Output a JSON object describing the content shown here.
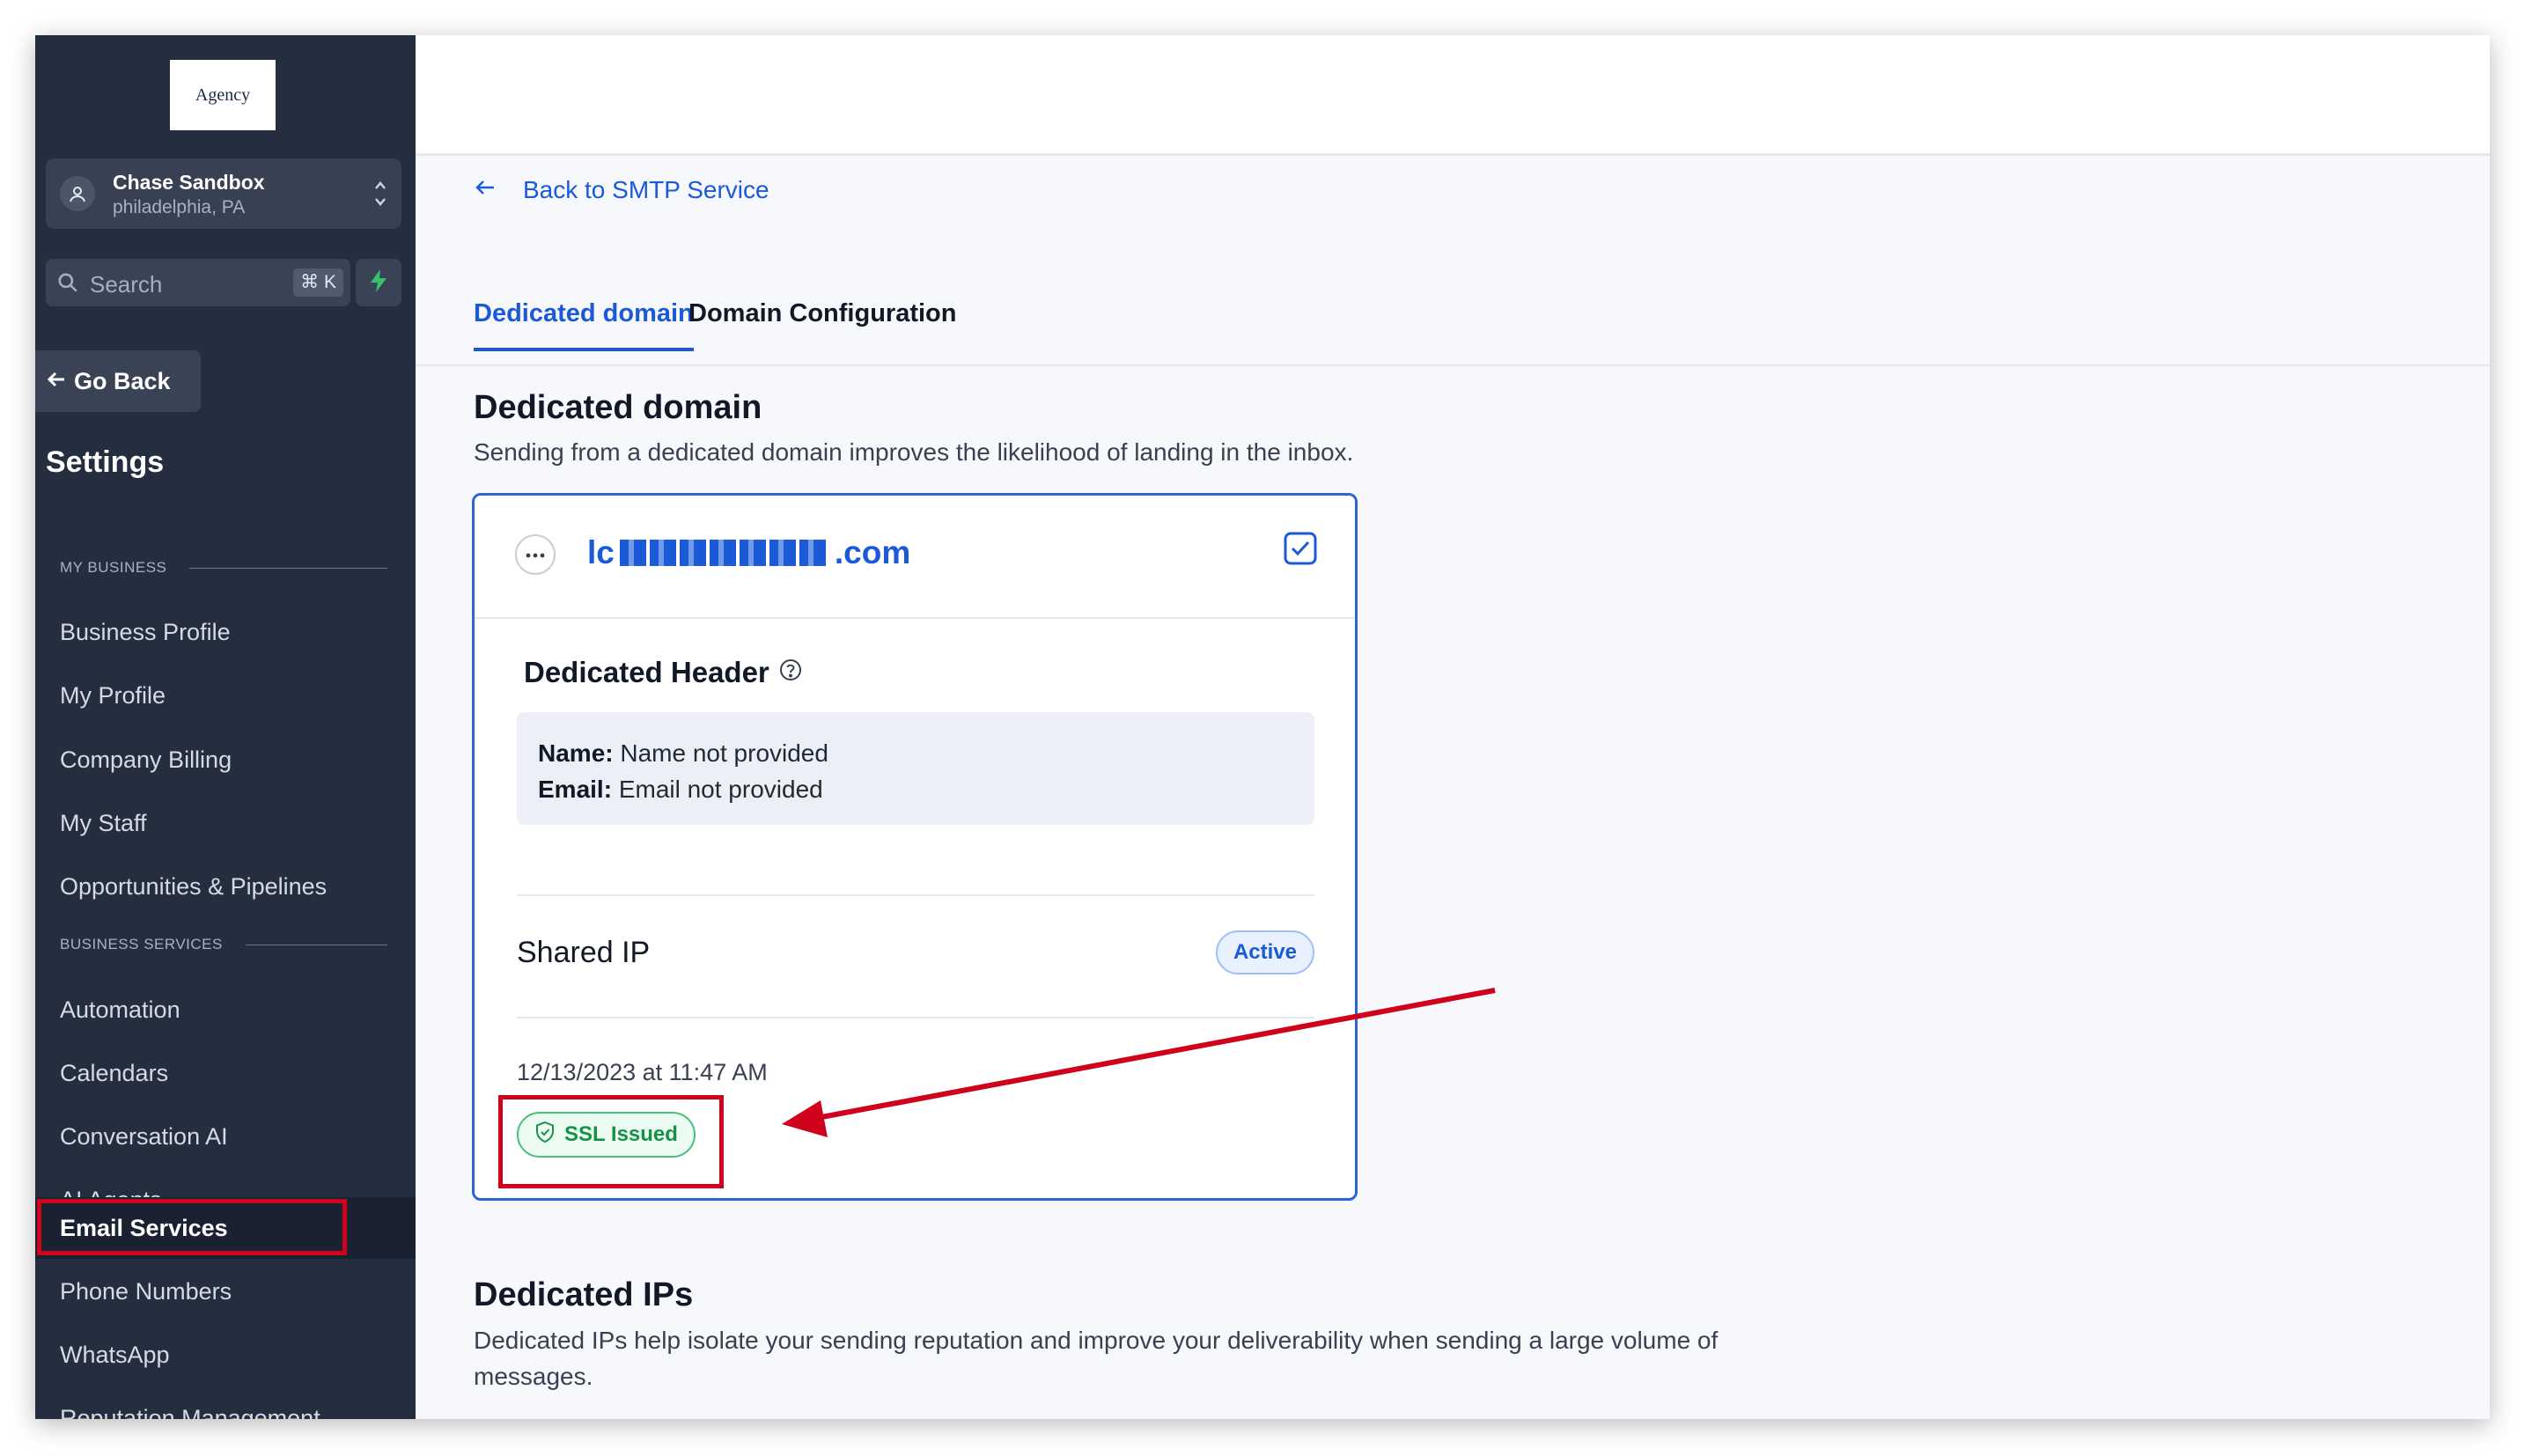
{
  "sidebar": {
    "logo_text": "Agency",
    "account": {
      "name": "Chase Sandbox",
      "location": "philadelphia, PA"
    },
    "search": {
      "placeholder": "Search",
      "shortcut": "⌘ K"
    },
    "go_back": "Go Back",
    "settings_title": "Settings",
    "sections": {
      "my_business": "MY BUSINESS",
      "business_services": "BUSINESS SERVICES"
    },
    "my_business_items": [
      "Business Profile",
      "My Profile",
      "Company Billing",
      "My Staff",
      "Opportunities & Pipelines"
    ],
    "business_services_items": [
      "Automation",
      "Calendars",
      "Conversation AI",
      "AI Agents",
      "Email Services",
      "Phone Numbers",
      "WhatsApp",
      "Reputation Management"
    ],
    "active_item": "Email Services"
  },
  "main": {
    "back_link": "Back to SMTP Service",
    "tabs": [
      {
        "label": "Dedicated domain",
        "active": true
      },
      {
        "label": "Domain Configuration",
        "active": false
      }
    ],
    "dedicated_domain": {
      "title": "Dedicated domain",
      "description": "Sending from a dedicated domain improves the likelihood of landing in the inbox."
    },
    "domain_card": {
      "domain_prefix": "lc",
      "domain_suffix": ".com",
      "header_title": "Dedicated Header",
      "name_label": "Name:",
      "name_value": "Name not provided",
      "email_label": "Email:",
      "email_value": "Email not provided",
      "ip_type": "Shared IP",
      "status": "Active",
      "issued_at": "12/13/2023 at 11:47 AM",
      "ssl_status": "SSL Issued"
    },
    "dedicated_ips": {
      "title": "Dedicated IPs",
      "description": "Dedicated IPs help isolate your sending reputation and improve your deliverability when sending a large volume of messages."
    }
  },
  "colors": {
    "accent": "#1a5ad7",
    "sidebar_bg": "#252e3f",
    "annotation_red": "#d0021b",
    "ssl_green": "#17914a"
  }
}
